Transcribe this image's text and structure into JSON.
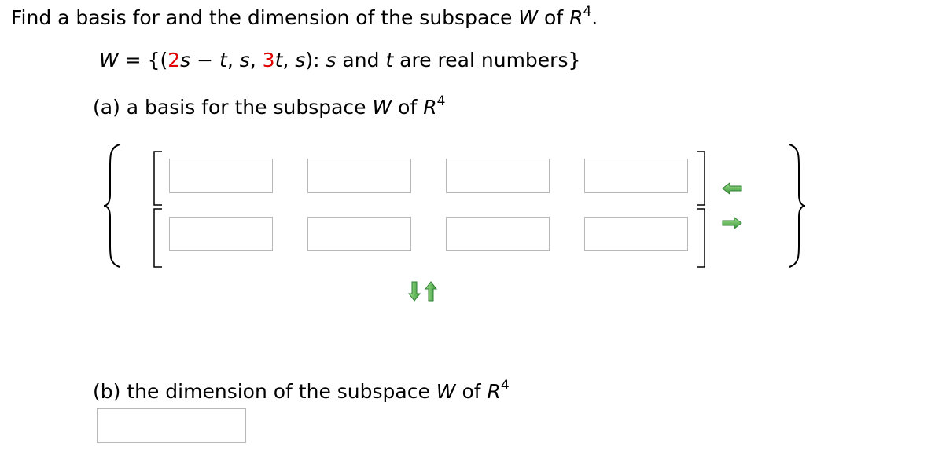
{
  "question": {
    "prompt_part1": "Find a basis for and the dimension of the subspace ",
    "prompt_W": "W",
    "prompt_of": " of ",
    "prompt_R": "R",
    "prompt_exp": "4",
    "prompt_end": "."
  },
  "set_definition": {
    "W": "W",
    "eq": " = {(",
    "coef1": "2",
    "s1": "s",
    "minus": " − ",
    "t1": "t",
    "comma1": ", ",
    "s2": "s",
    "comma2": ", ",
    "coef3": "3",
    "t3": "t",
    "comma3": ", ",
    "s4": "s",
    "close": "): ",
    "s5": "s",
    "and": " and ",
    "t5": "t",
    "rest": " are real numbers}"
  },
  "part_a": {
    "prefix": "(a) a basis for the subspace ",
    "W": "W",
    "of": " of ",
    "R": "R",
    "exp": "4"
  },
  "part_b": {
    "prefix": "(b) the dimension of the subspace ",
    "W": "W",
    "of": " of ",
    "R": "R",
    "exp": "4"
  },
  "basis_vectors": [
    {
      "components": [
        "",
        "",
        "",
        ""
      ]
    },
    {
      "components": [
        "",
        "",
        "",
        ""
      ]
    }
  ],
  "dimension_value": "",
  "icons": {
    "remove_vector": "arrow-left-icon",
    "add_vector": "arrow-right-icon",
    "remove_component": "arrow-down-icon",
    "add_component": "arrow-up-icon"
  },
  "colors": {
    "highlight": "#e00000",
    "arrow_green": "#4caf50",
    "field_border": "#b8b8b8"
  }
}
